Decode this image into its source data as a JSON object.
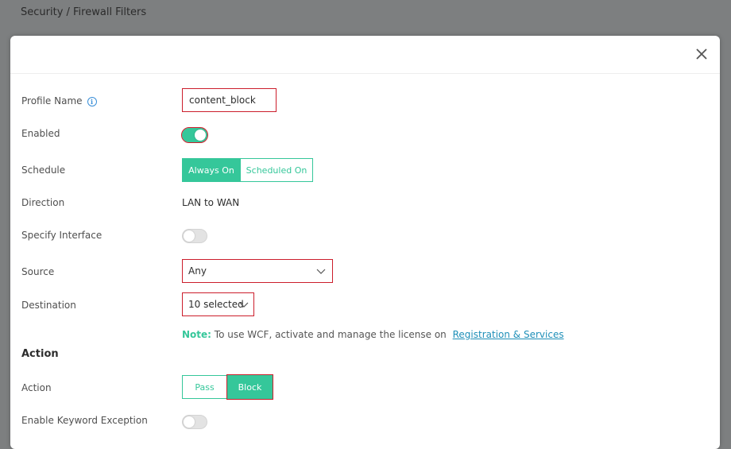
{
  "breadcrumb": "Security / Firewall Filters",
  "form": {
    "profile_name": {
      "label": "Profile Name",
      "value": "content_block"
    },
    "enabled": {
      "label": "Enabled",
      "on": true
    },
    "schedule": {
      "label": "Schedule",
      "options": [
        "Always On",
        "Scheduled On"
      ],
      "selected": "Always On"
    },
    "direction": {
      "label": "Direction",
      "value": "LAN to WAN"
    },
    "specify_interface": {
      "label": "Specify Interface",
      "on": false
    },
    "source": {
      "label": "Source",
      "value": "Any"
    },
    "destination": {
      "label": "Destination",
      "value": "10 selected"
    },
    "note": {
      "label": "Note:",
      "text": "To use WCF, activate and manage the license on",
      "link": "Registration & Services"
    }
  },
  "action_section": {
    "title": "Action",
    "action": {
      "label": "Action",
      "options": [
        "Pass",
        "Block"
      ],
      "selected": "Block"
    },
    "keyword_exception": {
      "label": "Enable Keyword Exception",
      "on": false
    }
  },
  "icons": {
    "close": "close-icon",
    "info": "info-icon",
    "dropdown": "chevron-down-icon"
  },
  "colors": {
    "accent": "#35c79a",
    "highlight": "#cc1e2c",
    "link": "#1e8fb8"
  }
}
